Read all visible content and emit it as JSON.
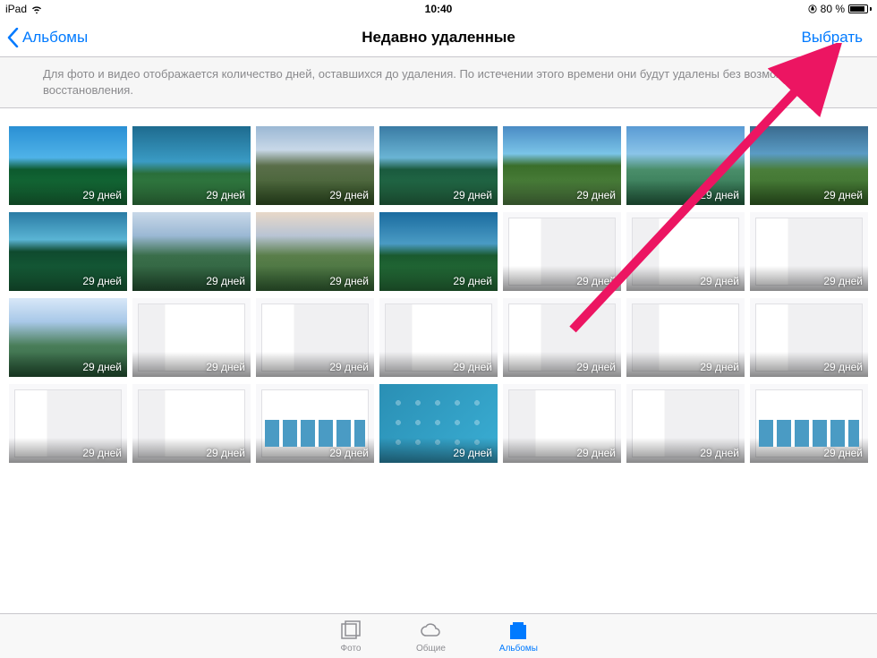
{
  "status": {
    "device": "iPad",
    "time": "10:40",
    "battery_pct": "80 %"
  },
  "nav": {
    "back_label": "Альбомы",
    "title": "Недавно удаленные",
    "select_label": "Выбрать"
  },
  "banner": {
    "text": "Для фото и видео отображается количество дней, оставшихся до удаления. По истечении этого времени они будут удалены без возможности восстановления."
  },
  "grid": {
    "days_label": "29 дней",
    "items": [
      {
        "t": "nature1"
      },
      {
        "t": "nature2"
      },
      {
        "t": "nature3"
      },
      {
        "t": "nature4"
      },
      {
        "t": "nature5"
      },
      {
        "t": "nature6"
      },
      {
        "t": "nature7"
      },
      {
        "t": "nature8"
      },
      {
        "t": "nature9"
      },
      {
        "t": "nature10"
      },
      {
        "t": "nature11"
      },
      {
        "t": "screenshot"
      },
      {
        "t": "screenshot screenshot2"
      },
      {
        "t": "screenshot"
      },
      {
        "t": "nature12"
      },
      {
        "t": "screenshot screenshot2"
      },
      {
        "t": "screenshot"
      },
      {
        "t": "screenshot screenshot2"
      },
      {
        "t": "screenshot"
      },
      {
        "t": "screenshot screenshot2"
      },
      {
        "t": "screenshot"
      },
      {
        "t": "screenshot"
      },
      {
        "t": "screenshot screenshot2"
      },
      {
        "t": "screenshot ss-grid"
      },
      {
        "t": "homescreen"
      },
      {
        "t": "screenshot screenshot2"
      },
      {
        "t": "screenshot"
      },
      {
        "t": "screenshot ss-grid"
      }
    ]
  },
  "tabs": {
    "photos": "Фото",
    "shared": "Общие",
    "albums": "Альбомы"
  }
}
